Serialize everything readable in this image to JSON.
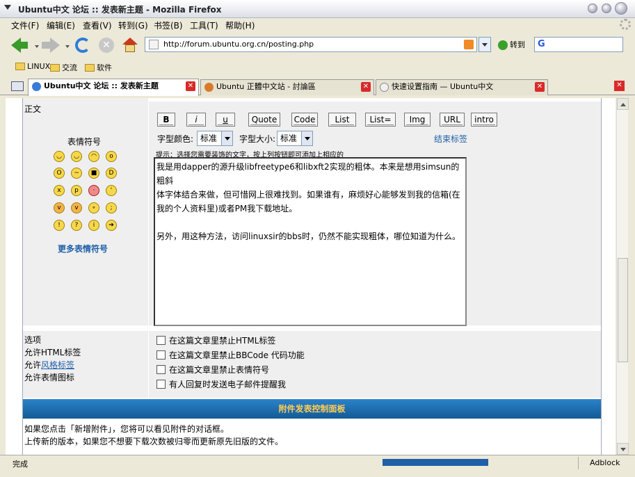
{
  "window": {
    "title": "Ubuntu中文 论坛 :: 发表新主题 - Mozilla Firefox"
  },
  "menu": [
    "文件(F)",
    "编辑(E)",
    "查看(V)",
    "转到(G)",
    "书签(B)",
    "工具(T)",
    "帮助(H)"
  ],
  "navbar": {
    "url": "http://forum.ubuntu.org.cn/posting.php",
    "go_label": "转到"
  },
  "bookmarks": [
    "LINUX",
    "交流",
    "软件"
  ],
  "tabs": [
    {
      "label": "Ubuntu中文 论坛 :: 发表新主题",
      "active": true
    },
    {
      "label": "Ubuntu 正體中文站 - 討論區",
      "active": false
    },
    {
      "label": "快速设置指南 — Ubuntu中文",
      "active": false
    }
  ],
  "form": {
    "body_label": "正文",
    "emoticon_title": "表情符号",
    "more_emoticons": "更多表情符号",
    "bbcode_buttons": [
      "B",
      "i",
      "u",
      "Quote",
      "Code",
      "List",
      "List=",
      "Img",
      "URL",
      "intro"
    ],
    "font_color_label": "字型颜色:",
    "font_color_value": "标准",
    "font_size_label": "字型大小:",
    "font_size_value": "标准",
    "close_tags": "结束标签",
    "hint": "提示：选择您需要装饰的文字，按上列按钮即可添加上相应的",
    "message_lines": [
      "我是用dapper的源升级libfreetype6和libxft2实现的粗体。本来是想用simsun的粗斜",
      "体字体结合来做，但可惜网上很难找到。如果谁有，麻烦好心能够发到我的信箱(在",
      "我的个人资料里)或者PM我下载地址。",
      "",
      "另外，用这种方法，访问linuxsir的bbs时，仍然不能实现粗体，哪位知道为什么。"
    ],
    "options_label": "选项",
    "options_info": [
      "允许HTML标签",
      "允许风格标签",
      "允许表情图标"
    ],
    "options_info_link": "风格标签",
    "checkboxes": [
      "在这篇文章里禁止HTML标签",
      "在这篇文章里禁止BBCode 代码功能",
      "在这篇文章里禁止表情符号",
      "有人回复时发送电子邮件提醒我"
    ],
    "attach_panel_title": "附件发表控制面板",
    "attach_text": [
      "如果您点击「新增附件」，您将可以看见附件的对话框。",
      "上传新的版本，如果您不想要下载次数被归零而更新原先旧版的文件。"
    ]
  },
  "status": {
    "text": "完成",
    "addon": "Adblock"
  }
}
